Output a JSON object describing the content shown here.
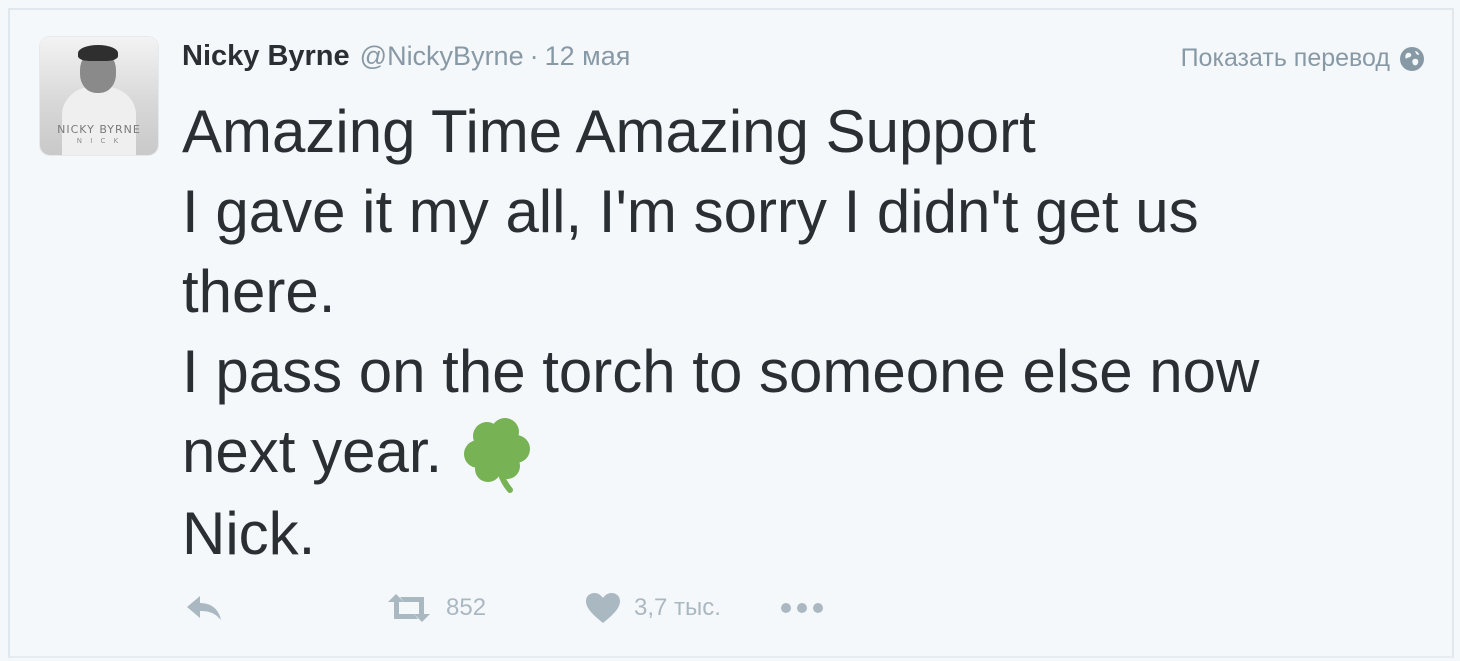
{
  "tweet": {
    "author": {
      "fullname": "Nicky Byrne",
      "username": "@NickyByrne",
      "avatar_text": "NICKY BYRNE",
      "avatar_subtext": "N I C K"
    },
    "separator": "·",
    "timestamp": "12 мая",
    "translate_label": "Показать перевод",
    "lines": [
      "Amazing Time Amazing Support",
      "I gave it my all, I'm sorry I didn't get us",
      "there.",
      "I pass on the torch to someone else now",
      "next year.",
      "Nick."
    ],
    "emoji": "shamrock-icon",
    "actions": {
      "reply_icon": "reply-icon",
      "retweet_icon": "retweet-icon",
      "retweet_count": "852",
      "like_icon": "heart-icon",
      "like_count": "3,7 тыс.",
      "more_icon": "more-icon"
    }
  },
  "colors": {
    "background": "#f5f8fa",
    "text": "#292f33",
    "muted": "#8899a6",
    "action": "#aab8c2",
    "clover": "#77b255"
  }
}
